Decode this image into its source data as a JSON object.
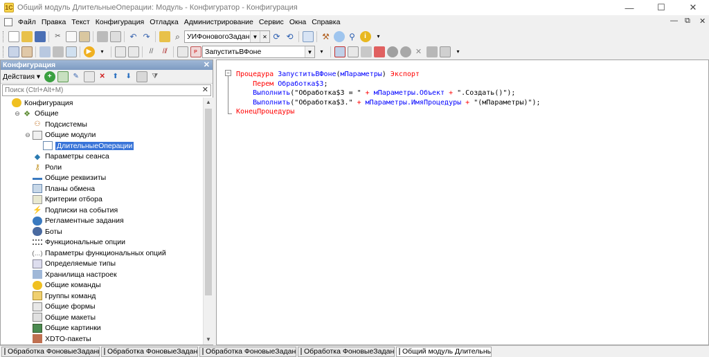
{
  "window": {
    "title": "Общий модуль ДлительныеОперации: Модуль - Конфигуратор - Конфигурация",
    "app_icon": "1c-logo-icon",
    "buttons": [
      "minimize",
      "maximize",
      "close"
    ]
  },
  "menu": [
    "Файл",
    "Правка",
    "Текст",
    "Конфигурация",
    "Отладка",
    "Администрирование",
    "Сервис",
    "Окна",
    "Справка"
  ],
  "toolbar1": {
    "combo_value": "УИФоновогоЗадания"
  },
  "toolbar2": {
    "combo_value": "ЗапуститьВФоне"
  },
  "panel": {
    "title": "Конфигурация",
    "actions_label": "Действия",
    "search_placeholder": "Поиск (Ctrl+Alt+M)",
    "tree": [
      {
        "label": "Конфигурация",
        "level": 0,
        "icon": "config-icon",
        "expander": ""
      },
      {
        "label": "Общие",
        "level": 1,
        "icon": "common-icon",
        "expander": "⊖"
      },
      {
        "label": "Подсистемы",
        "level": 2,
        "icon": "subsystems-icon",
        "expander": ""
      },
      {
        "label": "Общие модули",
        "level": 2,
        "icon": "common-modules-icon",
        "expander": "⊖"
      },
      {
        "label": "ДлительныеОперации",
        "level": 3,
        "icon": "module-icon",
        "expander": "",
        "selected": true
      },
      {
        "label": "Параметры сеанса",
        "level": 2,
        "icon": "session-params-icon",
        "expander": ""
      },
      {
        "label": "Роли",
        "level": 2,
        "icon": "roles-icon",
        "expander": ""
      },
      {
        "label": "Общие реквизиты",
        "level": 2,
        "icon": "common-attributes-icon",
        "expander": ""
      },
      {
        "label": "Планы обмена",
        "level": 2,
        "icon": "exchange-plans-icon",
        "expander": ""
      },
      {
        "label": "Критерии отбора",
        "level": 2,
        "icon": "filter-criteria-icon",
        "expander": ""
      },
      {
        "label": "Подписки на события",
        "level": 2,
        "icon": "event-subscriptions-icon",
        "expander": ""
      },
      {
        "label": "Регламентные задания",
        "level": 2,
        "icon": "scheduled-jobs-icon",
        "expander": ""
      },
      {
        "label": "Боты",
        "level": 2,
        "icon": "bots-icon",
        "expander": ""
      },
      {
        "label": "Функциональные опции",
        "level": 2,
        "icon": "functional-options-icon",
        "expander": ""
      },
      {
        "label": "Параметры функциональных опций",
        "level": 2,
        "icon": "fo-params-icon",
        "expander": ""
      },
      {
        "label": "Определяемые типы",
        "level": 2,
        "icon": "defined-types-icon",
        "expander": ""
      },
      {
        "label": "Хранилища настроек",
        "level": 2,
        "icon": "settings-storage-icon",
        "expander": ""
      },
      {
        "label": "Общие команды",
        "level": 2,
        "icon": "common-commands-icon",
        "expander": ""
      },
      {
        "label": "Группы команд",
        "level": 2,
        "icon": "command-groups-icon",
        "expander": ""
      },
      {
        "label": "Общие формы",
        "level": 2,
        "icon": "common-forms-icon",
        "expander": ""
      },
      {
        "label": "Общие макеты",
        "level": 2,
        "icon": "common-templates-icon",
        "expander": ""
      },
      {
        "label": "Общие картинки",
        "level": 2,
        "icon": "common-pictures-icon",
        "expander": ""
      },
      {
        "label": "XDTO-пакеты",
        "level": 2,
        "icon": "xdto-icon",
        "expander": ""
      }
    ]
  },
  "code": [
    [
      [
        "kw",
        "Процедура "
      ],
      [
        "id",
        "ЗапуститьВФоне"
      ],
      [
        "str",
        "("
      ],
      [
        "id",
        "мПараметры"
      ],
      [
        "str",
        ") "
      ],
      [
        "kw",
        "Экспорт"
      ]
    ],
    [
      [
        "str",
        "    "
      ],
      [
        "kw",
        "Перем "
      ],
      [
        "id",
        "Обработка$З"
      ],
      [
        "str",
        ";"
      ]
    ],
    [
      [
        "str",
        "    "
      ],
      [
        "id",
        "Выполнить"
      ],
      [
        "str",
        "(\"Обработка$З = \" "
      ],
      [
        "kw",
        "+ "
      ],
      [
        "id",
        "мПараметры.Объект"
      ],
      [
        "str",
        " "
      ],
      [
        "kw",
        "+"
      ],
      [
        "str",
        " \".Создать()\");"
      ]
    ],
    [
      [
        "str",
        "    "
      ],
      [
        "id",
        "Выполнить"
      ],
      [
        "str",
        "(\"Обработка$З.\" "
      ],
      [
        "kw",
        "+ "
      ],
      [
        "id",
        "мПараметры.ИмяПроцедуры"
      ],
      [
        "str",
        " "
      ],
      [
        "kw",
        "+"
      ],
      [
        "str",
        " \"(мПараметры)\");"
      ]
    ],
    [
      [
        "kw",
        "КонецПроцедуры"
      ]
    ]
  ],
  "taskbar": [
    {
      "label": "Обработка ФоновыеЗадания",
      "active": false
    },
    {
      "label": "Обработка ФоновыеЗадания...",
      "active": false
    },
    {
      "label": "Обработка ФоновыеЗадани...",
      "active": false
    },
    {
      "label": "Обработка ФоновыеЗадани...",
      "active": false
    },
    {
      "label": "Общий модуль Длительные...",
      "active": true
    }
  ],
  "colors": {
    "keyword": "#ff0000",
    "identifier": "#0000ff",
    "selection": "#3874d8",
    "panel_header": "#8aa6cc"
  }
}
